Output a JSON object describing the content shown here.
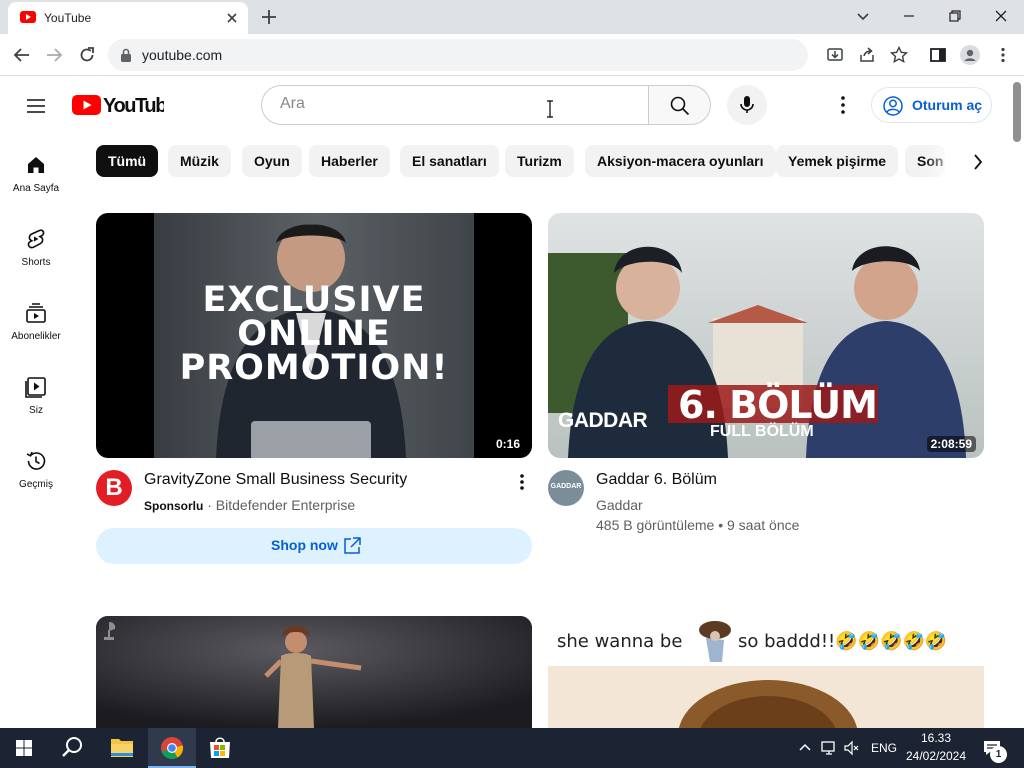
{
  "browser": {
    "tab_title": "YouTube",
    "url": "youtube.com"
  },
  "header": {
    "logo_text": "YouTube",
    "search_placeholder": "Ara",
    "signin_label": "Oturum aç"
  },
  "sidebar": {
    "items": [
      {
        "label": "Ana Sayfa",
        "icon": "home-icon"
      },
      {
        "label": "Shorts",
        "icon": "shorts-icon"
      },
      {
        "label": "Abonelikler",
        "icon": "subscriptions-icon"
      },
      {
        "label": "Siz",
        "icon": "you-icon"
      },
      {
        "label": "Geçmiş",
        "icon": "history-icon"
      }
    ]
  },
  "chips": [
    "Tümü",
    "Müzik",
    "Oyun",
    "Haberler",
    "El sanatları",
    "Turizm",
    "Aksiyon-macera oyunları",
    "Yemek pişirme",
    "Son"
  ],
  "videos": [
    {
      "thumb_text": [
        "EXCLUSIVE",
        "ONLINE",
        "PROMOTION!"
      ],
      "duration": "0:16",
      "avatar_letter": "B",
      "title": "GravityZone Small Business Security",
      "sponsored": "Sponsorlu",
      "separator": "·",
      "channel": "Bitdefender Enterprise",
      "cta": "Shop now"
    },
    {
      "thumb_brand": "GADDAR",
      "thumb_episode": "6. BÖLÜM",
      "thumb_sub": "FULL BÖLÜM",
      "duration": "2:08:59",
      "avatar_text": "GADDAR",
      "title": "Gaddar 6. Bölüm",
      "channel": "Gaddar",
      "views": "485 B görüntüleme",
      "separator": "•",
      "age": "9 saat önce"
    },
    {
      "thumb_logo": "grammy-icon"
    },
    {
      "caption_left": "she wanna be",
      "caption_right": "so baddd!!🤣🤣🤣🤣🤣"
    }
  ],
  "taskbar": {
    "language": "ENG",
    "time": "16.33",
    "date": "24/02/2024",
    "notification_count": "1"
  },
  "colors": {
    "youtube_red": "#ff0000",
    "link_blue": "#065fd4",
    "taskbar": "#1c2433"
  }
}
